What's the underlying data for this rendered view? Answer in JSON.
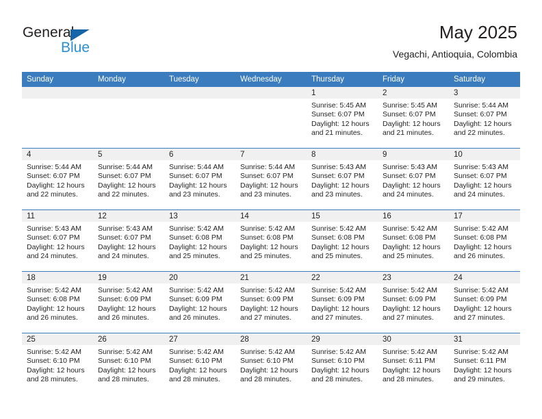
{
  "brand": {
    "name_part1": "General",
    "name_part2": "Blue",
    "accent_color": "#2b8fd6",
    "triangle_color": "#1565a8"
  },
  "header": {
    "title": "May 2025",
    "subtitle": "Vegachi, Antioquia, Colombia"
  },
  "calendar": {
    "header_color": "#3a7cbe",
    "daynum_band_color": "#f0f0f0",
    "weekday_headers": [
      "Sunday",
      "Monday",
      "Tuesday",
      "Wednesday",
      "Thursday",
      "Friday",
      "Saturday"
    ],
    "weeks": [
      [
        {
          "day": "",
          "sunrise": "",
          "sunset": "",
          "daylight_line1": "",
          "daylight_line2": ""
        },
        {
          "day": "",
          "sunrise": "",
          "sunset": "",
          "daylight_line1": "",
          "daylight_line2": ""
        },
        {
          "day": "",
          "sunrise": "",
          "sunset": "",
          "daylight_line1": "",
          "daylight_line2": ""
        },
        {
          "day": "",
          "sunrise": "",
          "sunset": "",
          "daylight_line1": "",
          "daylight_line2": ""
        },
        {
          "day": "1",
          "sunrise": "Sunrise: 5:45 AM",
          "sunset": "Sunset: 6:07 PM",
          "daylight_line1": "Daylight: 12 hours",
          "daylight_line2": "and 21 minutes."
        },
        {
          "day": "2",
          "sunrise": "Sunrise: 5:45 AM",
          "sunset": "Sunset: 6:07 PM",
          "daylight_line1": "Daylight: 12 hours",
          "daylight_line2": "and 21 minutes."
        },
        {
          "day": "3",
          "sunrise": "Sunrise: 5:44 AM",
          "sunset": "Sunset: 6:07 PM",
          "daylight_line1": "Daylight: 12 hours",
          "daylight_line2": "and 22 minutes."
        }
      ],
      [
        {
          "day": "4",
          "sunrise": "Sunrise: 5:44 AM",
          "sunset": "Sunset: 6:07 PM",
          "daylight_line1": "Daylight: 12 hours",
          "daylight_line2": "and 22 minutes."
        },
        {
          "day": "5",
          "sunrise": "Sunrise: 5:44 AM",
          "sunset": "Sunset: 6:07 PM",
          "daylight_line1": "Daylight: 12 hours",
          "daylight_line2": "and 22 minutes."
        },
        {
          "day": "6",
          "sunrise": "Sunrise: 5:44 AM",
          "sunset": "Sunset: 6:07 PM",
          "daylight_line1": "Daylight: 12 hours",
          "daylight_line2": "and 23 minutes."
        },
        {
          "day": "7",
          "sunrise": "Sunrise: 5:44 AM",
          "sunset": "Sunset: 6:07 PM",
          "daylight_line1": "Daylight: 12 hours",
          "daylight_line2": "and 23 minutes."
        },
        {
          "day": "8",
          "sunrise": "Sunrise: 5:43 AM",
          "sunset": "Sunset: 6:07 PM",
          "daylight_line1": "Daylight: 12 hours",
          "daylight_line2": "and 23 minutes."
        },
        {
          "day": "9",
          "sunrise": "Sunrise: 5:43 AM",
          "sunset": "Sunset: 6:07 PM",
          "daylight_line1": "Daylight: 12 hours",
          "daylight_line2": "and 24 minutes."
        },
        {
          "day": "10",
          "sunrise": "Sunrise: 5:43 AM",
          "sunset": "Sunset: 6:07 PM",
          "daylight_line1": "Daylight: 12 hours",
          "daylight_line2": "and 24 minutes."
        }
      ],
      [
        {
          "day": "11",
          "sunrise": "Sunrise: 5:43 AM",
          "sunset": "Sunset: 6:07 PM",
          "daylight_line1": "Daylight: 12 hours",
          "daylight_line2": "and 24 minutes."
        },
        {
          "day": "12",
          "sunrise": "Sunrise: 5:43 AM",
          "sunset": "Sunset: 6:07 PM",
          "daylight_line1": "Daylight: 12 hours",
          "daylight_line2": "and 24 minutes."
        },
        {
          "day": "13",
          "sunrise": "Sunrise: 5:42 AM",
          "sunset": "Sunset: 6:08 PM",
          "daylight_line1": "Daylight: 12 hours",
          "daylight_line2": "and 25 minutes."
        },
        {
          "day": "14",
          "sunrise": "Sunrise: 5:42 AM",
          "sunset": "Sunset: 6:08 PM",
          "daylight_line1": "Daylight: 12 hours",
          "daylight_line2": "and 25 minutes."
        },
        {
          "day": "15",
          "sunrise": "Sunrise: 5:42 AM",
          "sunset": "Sunset: 6:08 PM",
          "daylight_line1": "Daylight: 12 hours",
          "daylight_line2": "and 25 minutes."
        },
        {
          "day": "16",
          "sunrise": "Sunrise: 5:42 AM",
          "sunset": "Sunset: 6:08 PM",
          "daylight_line1": "Daylight: 12 hours",
          "daylight_line2": "and 25 minutes."
        },
        {
          "day": "17",
          "sunrise": "Sunrise: 5:42 AM",
          "sunset": "Sunset: 6:08 PM",
          "daylight_line1": "Daylight: 12 hours",
          "daylight_line2": "and 26 minutes."
        }
      ],
      [
        {
          "day": "18",
          "sunrise": "Sunrise: 5:42 AM",
          "sunset": "Sunset: 6:08 PM",
          "daylight_line1": "Daylight: 12 hours",
          "daylight_line2": "and 26 minutes."
        },
        {
          "day": "19",
          "sunrise": "Sunrise: 5:42 AM",
          "sunset": "Sunset: 6:09 PM",
          "daylight_line1": "Daylight: 12 hours",
          "daylight_line2": "and 26 minutes."
        },
        {
          "day": "20",
          "sunrise": "Sunrise: 5:42 AM",
          "sunset": "Sunset: 6:09 PM",
          "daylight_line1": "Daylight: 12 hours",
          "daylight_line2": "and 26 minutes."
        },
        {
          "day": "21",
          "sunrise": "Sunrise: 5:42 AM",
          "sunset": "Sunset: 6:09 PM",
          "daylight_line1": "Daylight: 12 hours",
          "daylight_line2": "and 27 minutes."
        },
        {
          "day": "22",
          "sunrise": "Sunrise: 5:42 AM",
          "sunset": "Sunset: 6:09 PM",
          "daylight_line1": "Daylight: 12 hours",
          "daylight_line2": "and 27 minutes."
        },
        {
          "day": "23",
          "sunrise": "Sunrise: 5:42 AM",
          "sunset": "Sunset: 6:09 PM",
          "daylight_line1": "Daylight: 12 hours",
          "daylight_line2": "and 27 minutes."
        },
        {
          "day": "24",
          "sunrise": "Sunrise: 5:42 AM",
          "sunset": "Sunset: 6:09 PM",
          "daylight_line1": "Daylight: 12 hours",
          "daylight_line2": "and 27 minutes."
        }
      ],
      [
        {
          "day": "25",
          "sunrise": "Sunrise: 5:42 AM",
          "sunset": "Sunset: 6:10 PM",
          "daylight_line1": "Daylight: 12 hours",
          "daylight_line2": "and 28 minutes."
        },
        {
          "day": "26",
          "sunrise": "Sunrise: 5:42 AM",
          "sunset": "Sunset: 6:10 PM",
          "daylight_line1": "Daylight: 12 hours",
          "daylight_line2": "and 28 minutes."
        },
        {
          "day": "27",
          "sunrise": "Sunrise: 5:42 AM",
          "sunset": "Sunset: 6:10 PM",
          "daylight_line1": "Daylight: 12 hours",
          "daylight_line2": "and 28 minutes."
        },
        {
          "day": "28",
          "sunrise": "Sunrise: 5:42 AM",
          "sunset": "Sunset: 6:10 PM",
          "daylight_line1": "Daylight: 12 hours",
          "daylight_line2": "and 28 minutes."
        },
        {
          "day": "29",
          "sunrise": "Sunrise: 5:42 AM",
          "sunset": "Sunset: 6:10 PM",
          "daylight_line1": "Daylight: 12 hours",
          "daylight_line2": "and 28 minutes."
        },
        {
          "day": "30",
          "sunrise": "Sunrise: 5:42 AM",
          "sunset": "Sunset: 6:11 PM",
          "daylight_line1": "Daylight: 12 hours",
          "daylight_line2": "and 28 minutes."
        },
        {
          "day": "31",
          "sunrise": "Sunrise: 5:42 AM",
          "sunset": "Sunset: 6:11 PM",
          "daylight_line1": "Daylight: 12 hours",
          "daylight_line2": "and 29 minutes."
        }
      ]
    ]
  }
}
